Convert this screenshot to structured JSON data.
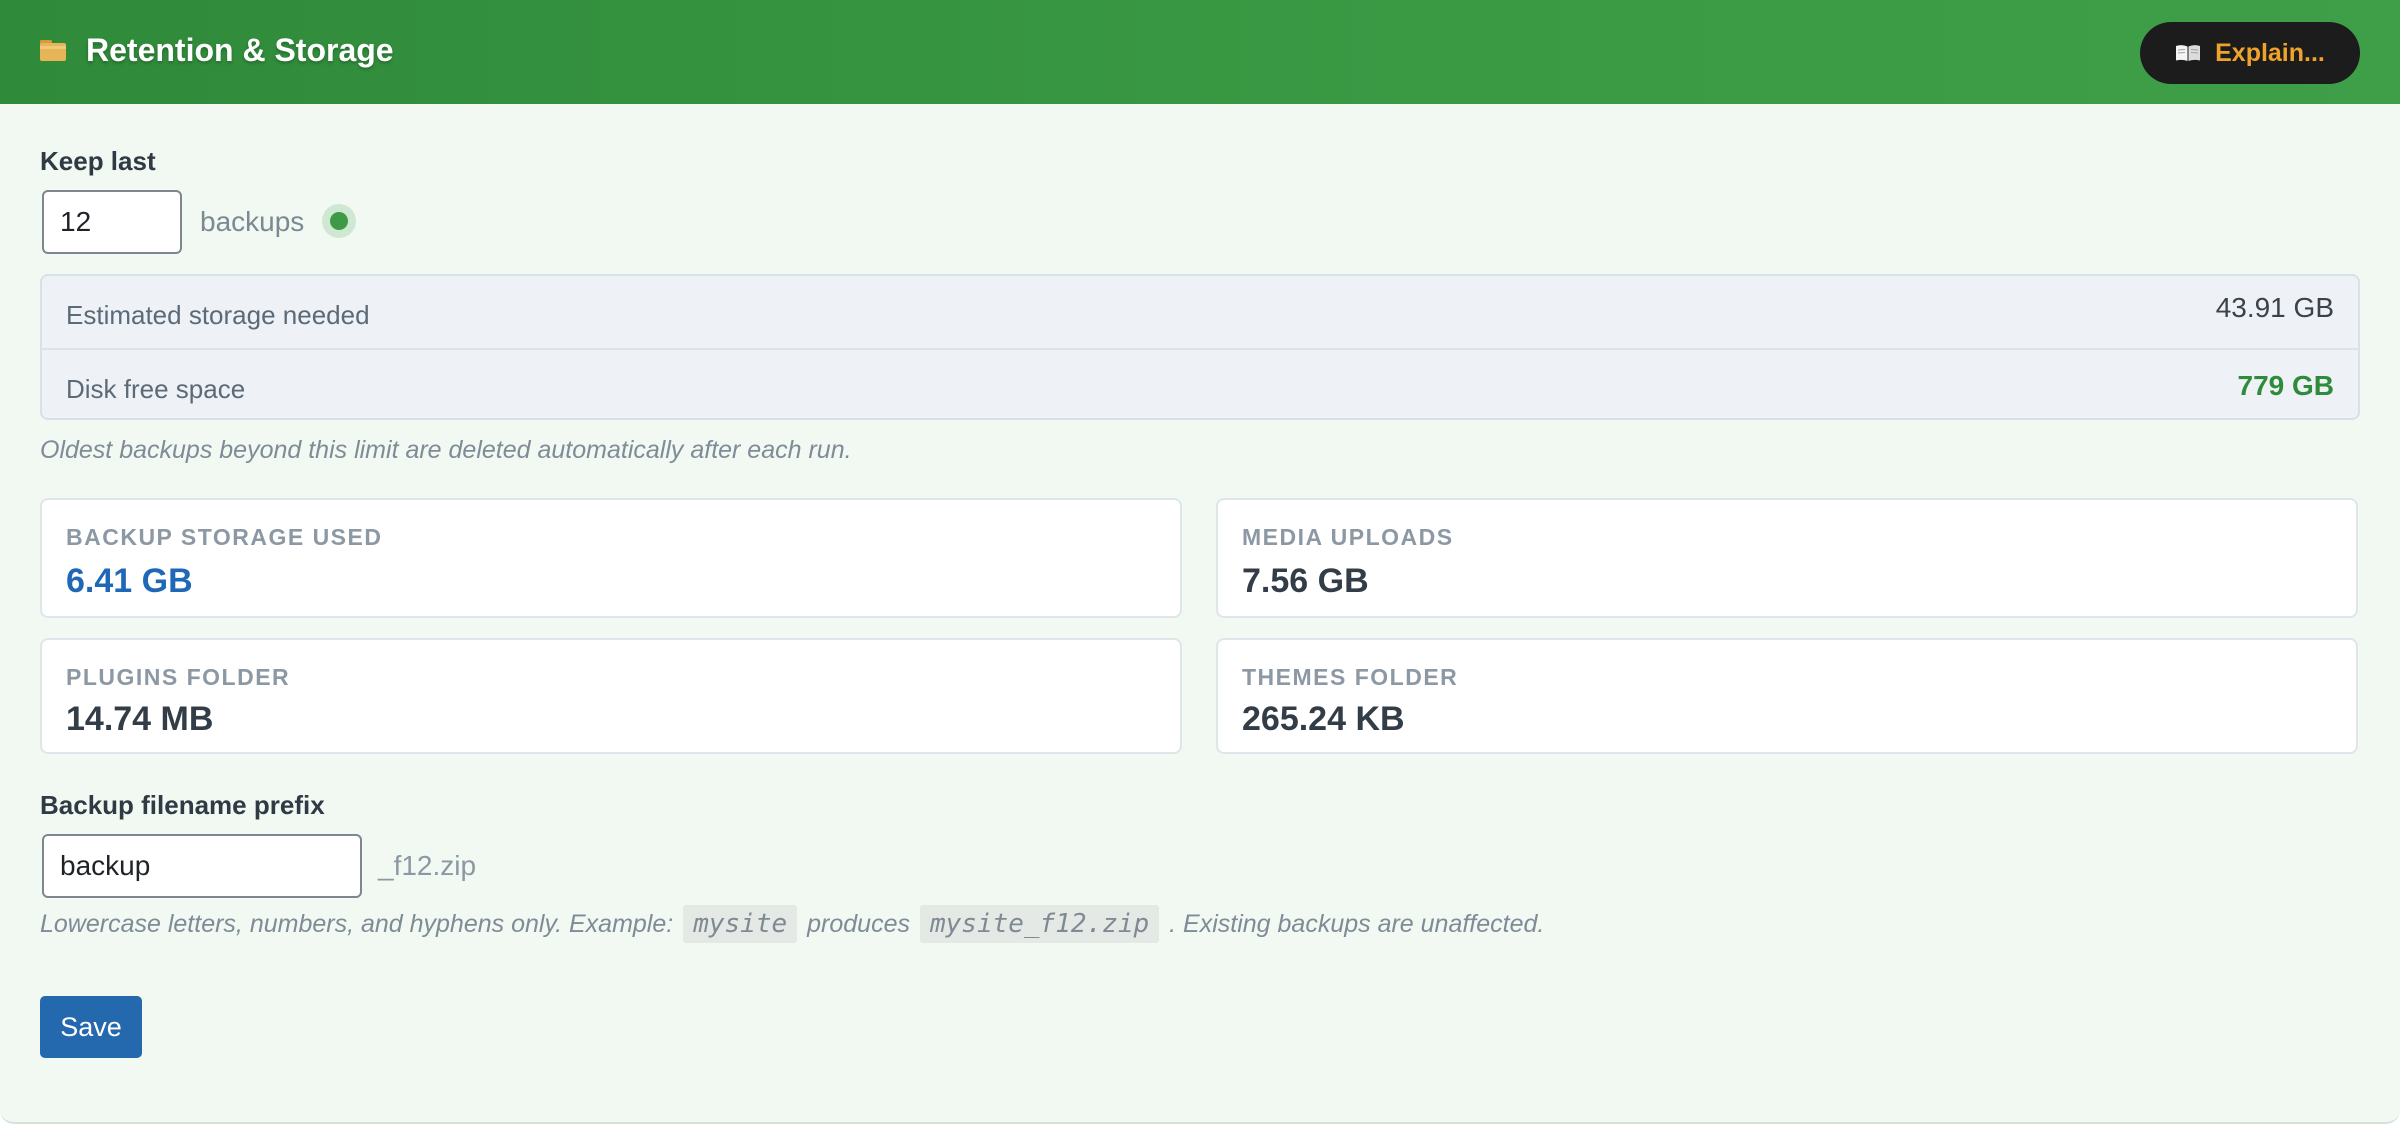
{
  "header": {
    "icon": "folder-icon",
    "title": "Retention & Storage",
    "explain_button": {
      "icon": "open-book-icon",
      "label": "Explain..."
    }
  },
  "retention": {
    "label": "Keep last",
    "value": "12",
    "unit": "backups",
    "status_color": "#3e9a46"
  },
  "estimate": {
    "rows": [
      {
        "label": "Estimated storage needed",
        "value": "43.91 GB"
      },
      {
        "label": "Disk free space",
        "value": "779 GB"
      }
    ]
  },
  "retention_note": "Oldest backups beyond this limit are deleted automatically after each run.",
  "stats": [
    {
      "caption": "BACKUP STORAGE USED",
      "value": "6.41 GB"
    },
    {
      "caption": "MEDIA UPLOADS",
      "value": "7.56 GB"
    },
    {
      "caption": "PLUGINS FOLDER",
      "value": "14.74 MB"
    },
    {
      "caption": "THEMES FOLDER",
      "value": "265.24 KB"
    }
  ],
  "prefix": {
    "label": "Backup filename prefix",
    "value": "backup",
    "suffix": "_f12.zip"
  },
  "prefix_note": {
    "part1": "Lowercase letters, numbers, and hyphens only. Example:",
    "example_code": "mysite",
    "part2": "produces",
    "result_code": "mysite_f12.zip",
    "part3": ". Existing backups are unaffected."
  },
  "save_label": "Save",
  "colors": {
    "header_green": "#3a9a44",
    "accent_orange": "#f0a32a",
    "link_blue": "#1f68b8",
    "free_green": "#2f8a3a",
    "button_blue": "#2469ad"
  }
}
